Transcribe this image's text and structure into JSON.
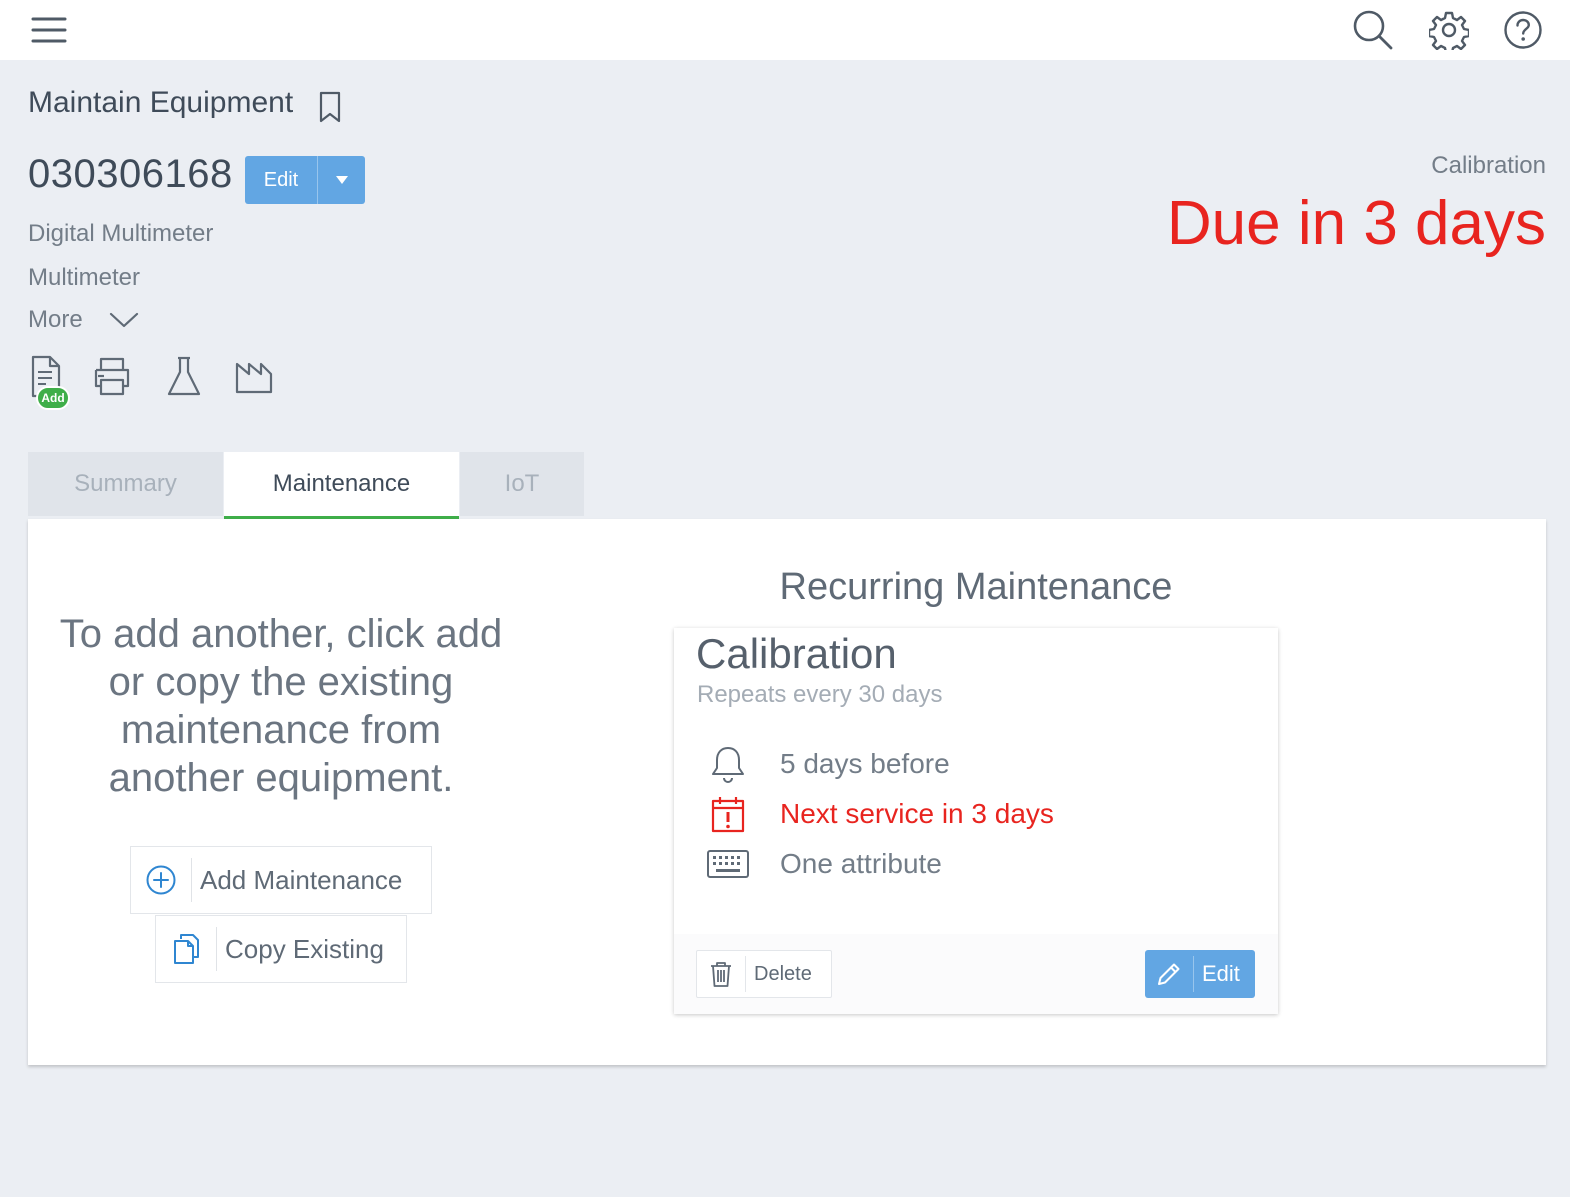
{
  "header": {
    "icons": [
      "hamburger-menu-icon",
      "search-icon",
      "gear-icon",
      "help-icon"
    ]
  },
  "page": {
    "title": "Maintain Equipment",
    "equipment_id": "030306168",
    "edit_label": "Edit",
    "description": "Digital Multimeter",
    "type": "Multimeter",
    "more_label": "More",
    "add_badge": "Add",
    "toolbar_icons": [
      "document-add-icon",
      "printer-icon",
      "flask-icon",
      "factory-icon"
    ]
  },
  "status": {
    "label": "Calibration",
    "due": "Due in 3 days",
    "due_color": "#e8241f"
  },
  "tabs": [
    {
      "label": "Summary",
      "active": false
    },
    {
      "label": "Maintenance",
      "active": true
    },
    {
      "label": "IoT",
      "active": false
    }
  ],
  "maintenance": {
    "hint": "To add another, click add or copy the existing maintenance from another equipment.",
    "add_label": "Add Maintenance",
    "copy_label": "Copy Existing",
    "section_title": "Recurring Maintenance",
    "card": {
      "title": "Calibration",
      "repeats": "Repeats every 30 days",
      "details": [
        {
          "icon": "bell-icon",
          "text": "5 days before"
        },
        {
          "icon": "calendar-alert-icon",
          "text": "Next service in 3 days"
        },
        {
          "icon": "keyboard-icon",
          "text": "One attribute"
        }
      ],
      "delete_label": "Delete",
      "edit_label": "Edit"
    }
  },
  "colors": {
    "accent_blue": "#62a6e3",
    "success_green": "#3fae49",
    "alert_red": "#e8241f",
    "background": "#ebeef3"
  }
}
